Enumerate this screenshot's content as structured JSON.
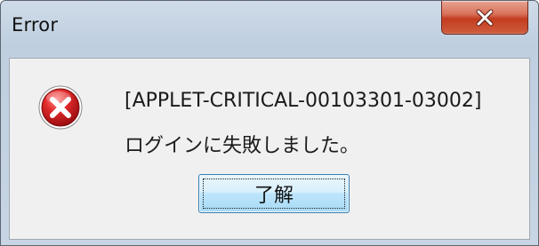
{
  "window": {
    "title": "Error",
    "close_icon": "close-icon"
  },
  "dialog": {
    "icon": "error-icon",
    "error_code": "[APPLET-CRITICAL-00103301-03002]",
    "message": "ログインに失敗しました。",
    "ok_button_label": "了解"
  },
  "colors": {
    "close_button": "#c33b1f",
    "error_icon": "#c8181c",
    "ok_button_border": "#3c7fb1",
    "client_background": "#f0f0f0"
  }
}
